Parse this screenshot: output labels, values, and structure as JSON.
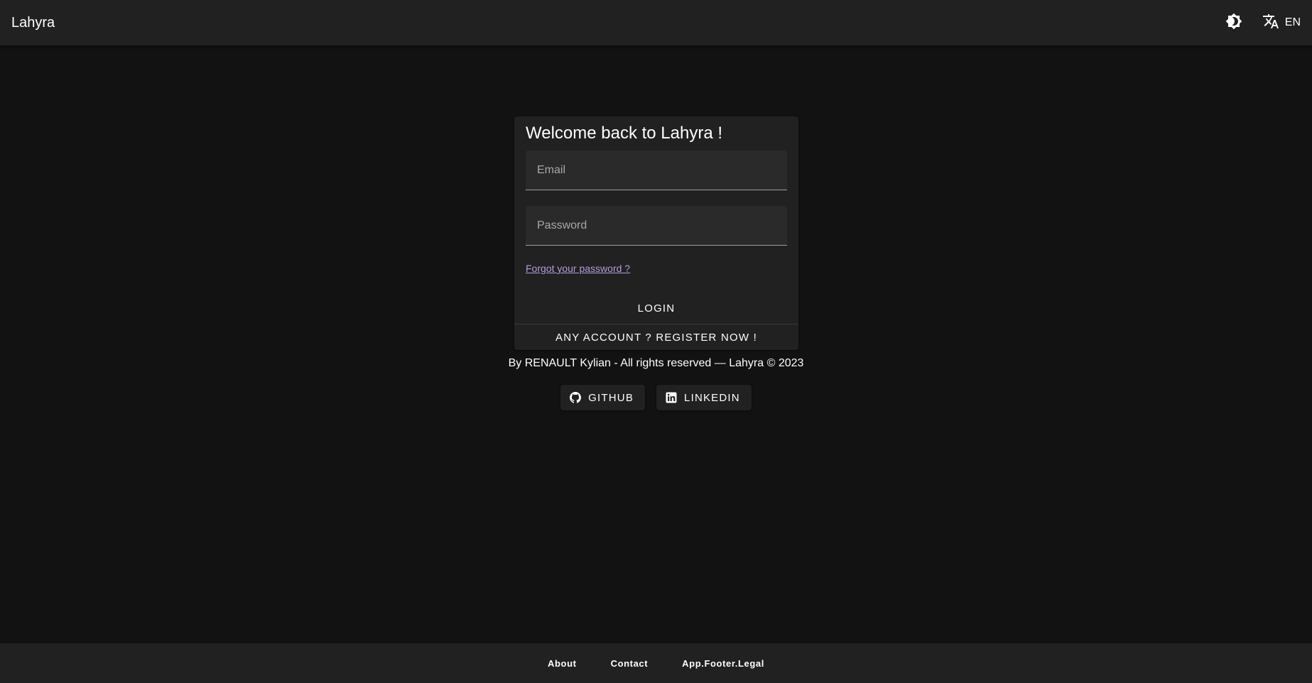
{
  "app_bar": {
    "title": "Lahyra",
    "theme_toggle_icon": "brightness-icon",
    "translate_icon": "translate-icon",
    "language_code": "EN"
  },
  "login": {
    "title": "Welcome back to Lahyra !",
    "email_placeholder": "Email",
    "email_value": "",
    "password_placeholder": "Password",
    "password_value": "",
    "forgot_password_label": "Forgot your password ?",
    "login_label": "LOGIN",
    "register_label": "ANY ACCOUNT ? REGISTER NOW !"
  },
  "credits": {
    "copyright": "By RENAULT Kylian - All rights reserved — Lahyra © 2023",
    "github_label": "GITHUB",
    "github_icon": "github-icon",
    "linkedin_label": "LINKEDIN",
    "linkedin_icon": "linkedin-icon"
  },
  "footer": {
    "links": [
      "About",
      "Contact",
      "App.Footer.Legal"
    ]
  },
  "colors": {
    "background": "#121212",
    "surface": "#212121",
    "link": "#b39ddb"
  }
}
